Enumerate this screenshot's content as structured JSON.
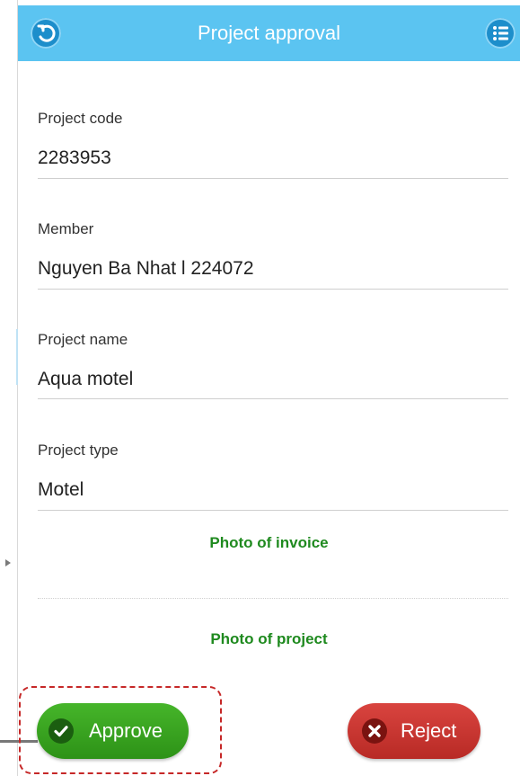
{
  "header": {
    "title": "Project approval",
    "back_icon": "back-arrow-icon",
    "menu_icon": "list-menu-icon",
    "color": "#5bc4f1"
  },
  "fields": [
    {
      "label": "Project code",
      "value": "2283953"
    },
    {
      "label": "Member",
      "value": "Nguyen Ba Nhat l 224072"
    },
    {
      "label": "Project name",
      "value": "Aqua motel"
    },
    {
      "label": "Project type",
      "value": "Motel"
    }
  ],
  "photos": {
    "invoice_label": "Photo of invoice",
    "project_label": "Photo of project",
    "color": "#1f8a1f"
  },
  "actions": {
    "approve_label": "Approve",
    "approve_icon": "check-circle-icon",
    "approve_color": "#3aa521",
    "reject_label": "Reject",
    "reject_icon": "x-circle-icon",
    "reject_color": "#c9352f",
    "highlight_color": "#c62828"
  }
}
